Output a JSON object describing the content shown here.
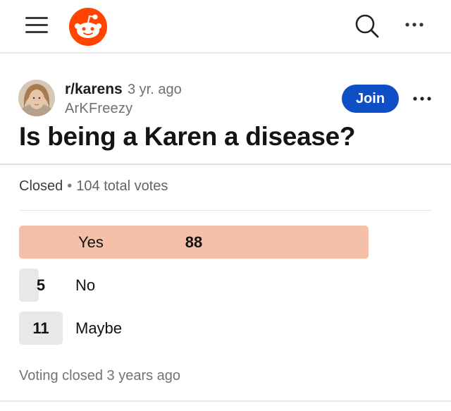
{
  "header": {
    "icons": {
      "menu": "hamburger-menu-icon",
      "logo": "reddit-logo-icon",
      "search": "search-icon",
      "more": "more-horizontal-icon"
    },
    "colors": {
      "logo": "#ff4500"
    }
  },
  "post": {
    "subreddit": "r/karens",
    "age": "3 yr. ago",
    "author": "ArKFreezy",
    "join_label": "Join",
    "title": "Is being a Karen a disease?",
    "colors": {
      "join_button": "#0f4fc6"
    }
  },
  "poll": {
    "status": "Closed",
    "total_votes_text": "104 total votes",
    "total_votes": 104,
    "options": [
      {
        "count": "88",
        "label": "Yes",
        "votes": 88,
        "winner": true
      },
      {
        "count": "5",
        "label": "No",
        "votes": 5,
        "winner": false
      },
      {
        "count": "11",
        "label": "Maybe",
        "votes": 11,
        "winner": false
      }
    ],
    "footer": "Voting closed 3 years ago",
    "colors": {
      "winner_bar": "#f4c0a9",
      "other_bar": "#e6e8ea"
    }
  }
}
